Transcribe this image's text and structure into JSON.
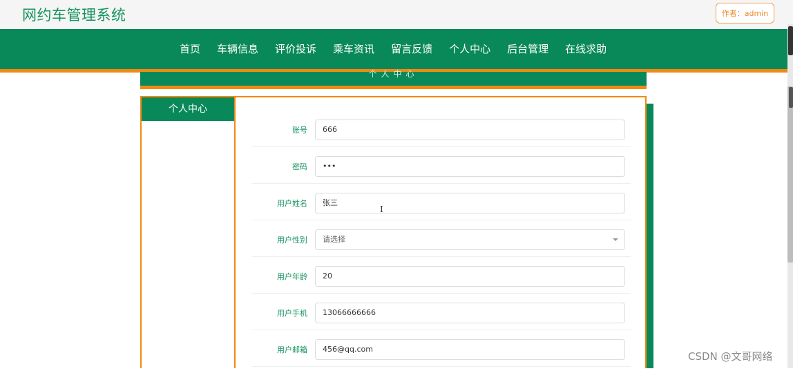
{
  "header": {
    "app_title": "网约车管理系统",
    "author_badge": "作者：admin"
  },
  "nav": {
    "items": [
      "首页",
      "车辆信息",
      "评价投诉",
      "乘车资讯",
      "留言反馈",
      "个人中心",
      "后台管理",
      "在线求助"
    ]
  },
  "section": {
    "title": "个人中心"
  },
  "sidebar": {
    "items": [
      "个人中心"
    ]
  },
  "form": {
    "fields": [
      {
        "label": "账号",
        "value": "666"
      },
      {
        "label": "密码",
        "value": "•••"
      },
      {
        "label": "用户姓名",
        "value": "张三"
      },
      {
        "label": "用户性别",
        "value": "请选择"
      },
      {
        "label": "用户年龄",
        "value": "20"
      },
      {
        "label": "用户手机",
        "value": "13066666666"
      },
      {
        "label": "用户邮箱",
        "value": "456@qq.com"
      }
    ]
  },
  "watermark": "CSDN @文哥网络",
  "colors": {
    "primary": "#09885a",
    "accent": "#f08a12",
    "title": "#13935f"
  }
}
